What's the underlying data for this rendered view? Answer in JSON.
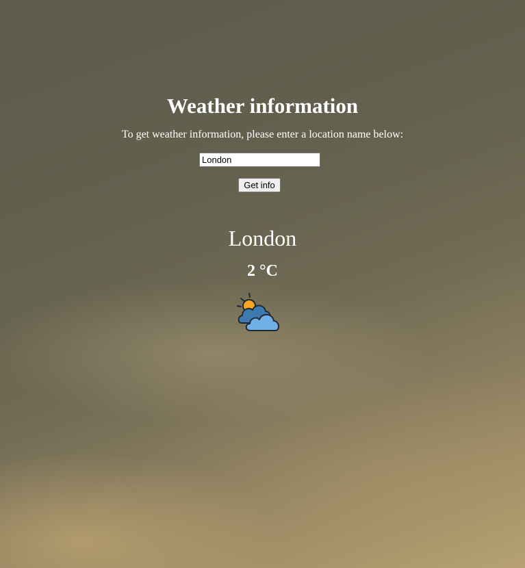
{
  "page": {
    "title": "Weather information",
    "instructions": "To get weather information, please enter a location name below:"
  },
  "search": {
    "value": "London",
    "button_label": "Get info"
  },
  "result": {
    "city": "London",
    "temperature": "2 °C",
    "condition_icon": "partly-cloudy-icon"
  },
  "colors": {
    "text": "#ffffff",
    "cloud_dark": "#3d7ab0",
    "cloud_light": "#6fb0e6",
    "sun": "#f5a623",
    "outline": "#1f2a33"
  }
}
